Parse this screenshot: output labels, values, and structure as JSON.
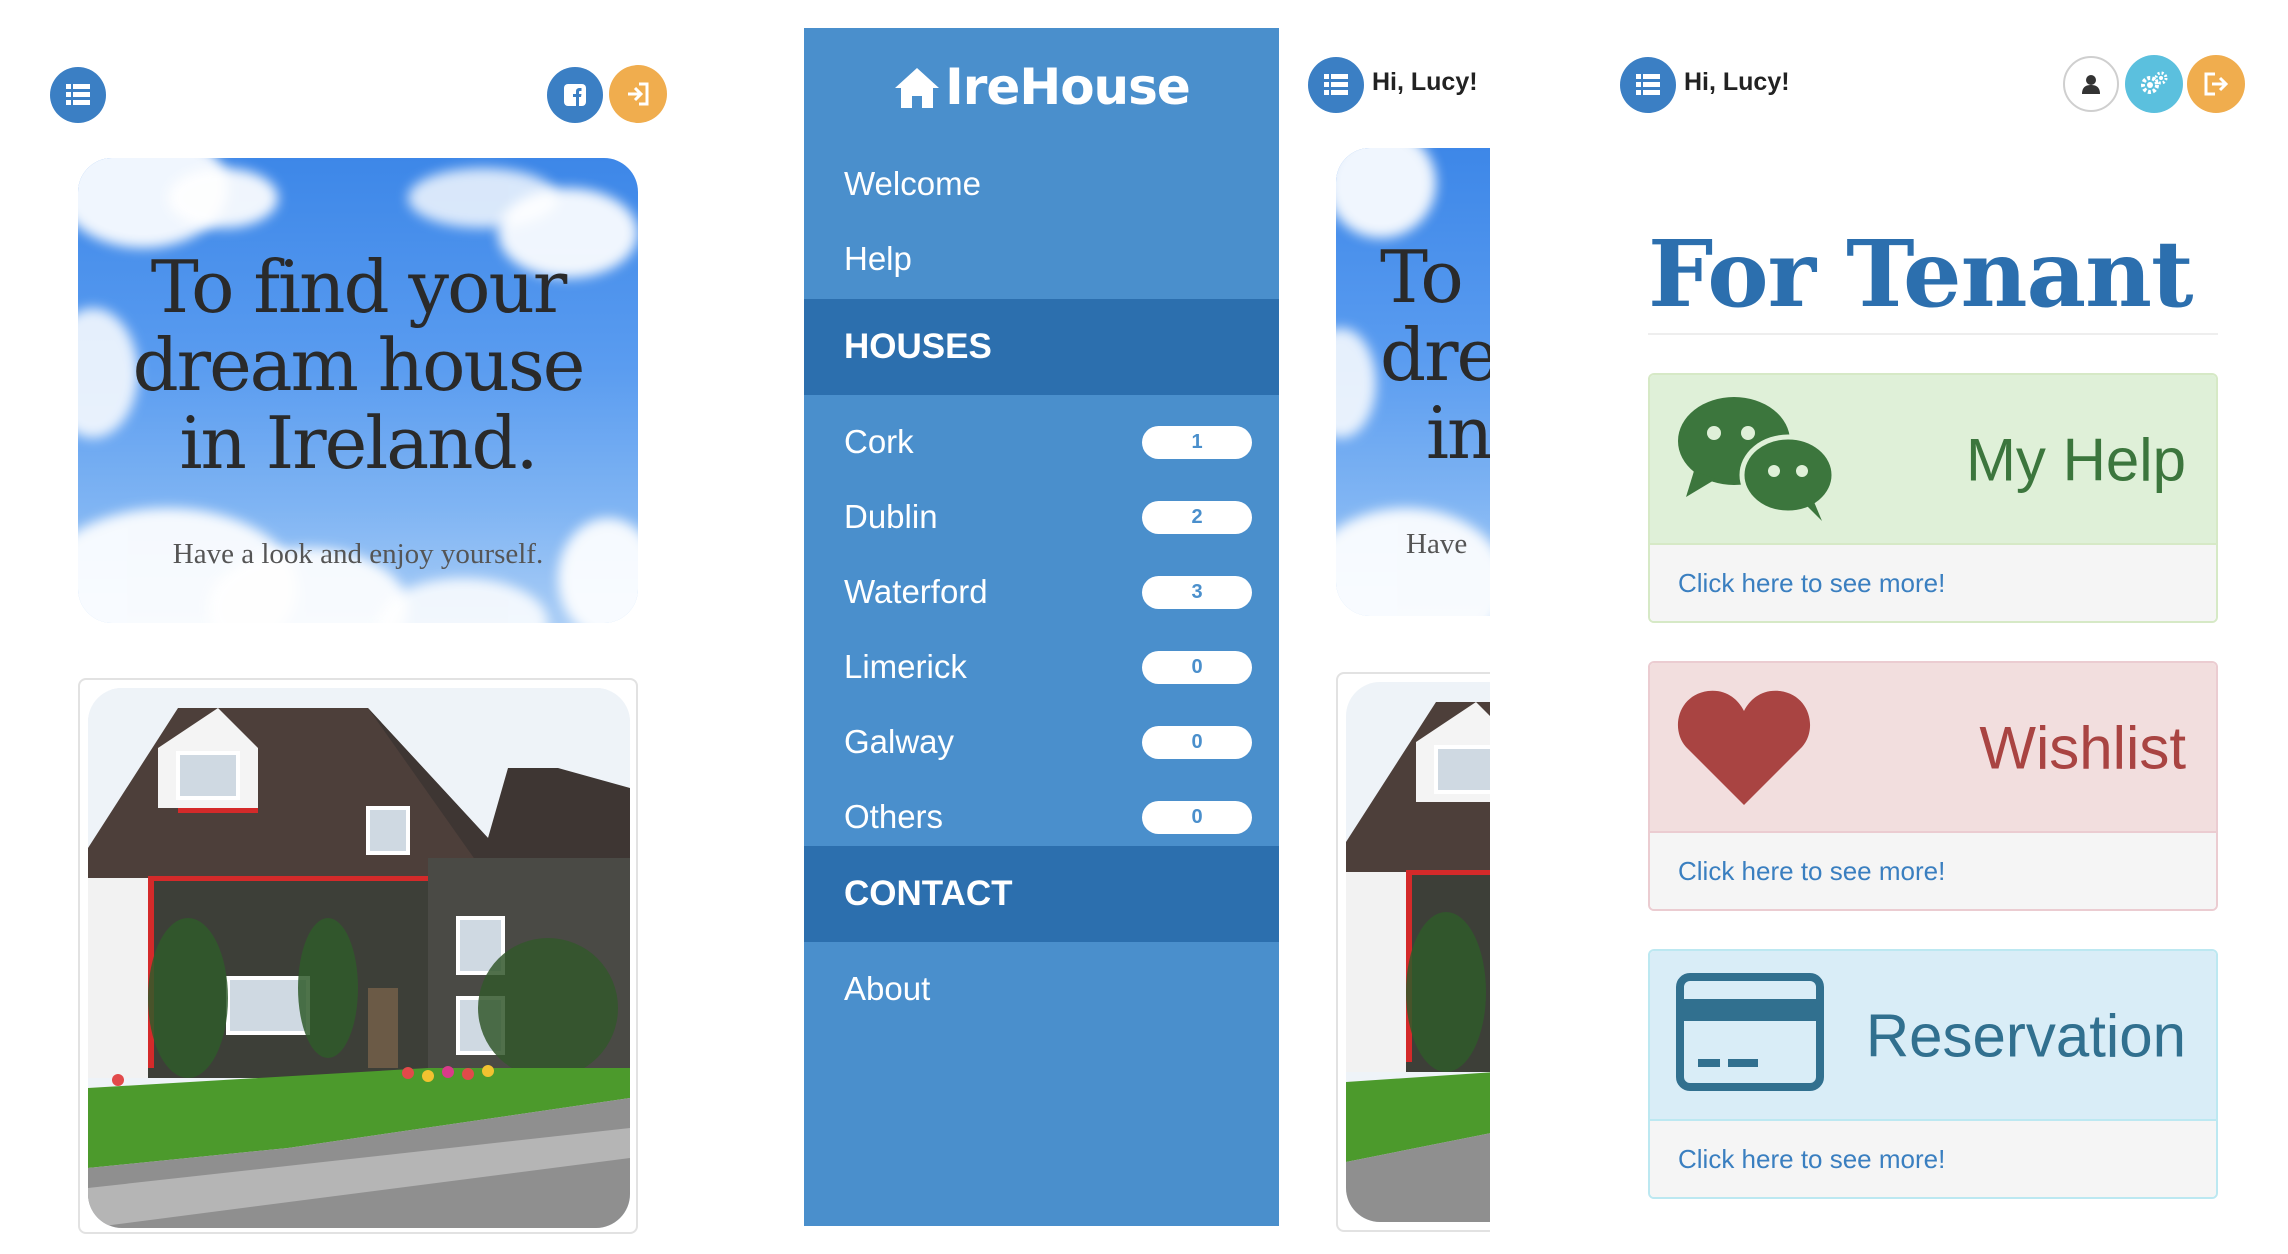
{
  "panel1": {
    "hero": {
      "title_line1": "To find your",
      "title_line2": "dream house",
      "title_line3": "in Ireland.",
      "subtitle": "Have a look and enjoy yourself."
    },
    "icons": [
      "list-icon",
      "facebook-icon",
      "sign-in-icon"
    ]
  },
  "menu": {
    "brand": "IreHouse",
    "items_top": [
      {
        "label": "Welcome"
      },
      {
        "label": "Help"
      }
    ],
    "houses_header": "HOUSES",
    "houses": [
      {
        "label": "Cork",
        "count": "1"
      },
      {
        "label": "Dublin",
        "count": "2"
      },
      {
        "label": "Waterford",
        "count": "3"
      },
      {
        "label": "Limerick",
        "count": "0"
      },
      {
        "label": "Galway",
        "count": "0"
      },
      {
        "label": "Others",
        "count": "0"
      }
    ],
    "contact_header": "CONTACT",
    "contact_items": [
      {
        "label": "About"
      }
    ]
  },
  "panel3": {
    "greeting": "Hi, Lucy!",
    "hero_partial_line1": "To",
    "hero_partial_line2": "dre",
    "hero_partial_line3": "in",
    "hero_partial_sub": "Have"
  },
  "panel4": {
    "greeting": "Hi, Lucy!",
    "title": "For Tenant",
    "cards": [
      {
        "label": "My Help",
        "link": "Click here to see more!",
        "icon": "wechat-icon",
        "color": "#3c763d",
        "bg": "#dff0d8",
        "border": "#d6e9c6"
      },
      {
        "label": "Wishlist",
        "link": "Click here to see more!",
        "icon": "heart-icon",
        "color": "#a94442",
        "bg": "#f2dede",
        "border": "#ebccd1"
      },
      {
        "label": "Reservation",
        "link": "Click here to see more!",
        "icon": "credit-card-icon",
        "color": "#31708f",
        "bg": "#d9edf7",
        "border": "#bce8f1"
      }
    ]
  },
  "colors": {
    "primary": "#3b7fc4",
    "menu_bg": "#4a8fcc",
    "menu_header": "#2c6fae",
    "orange": "#f0ad4e",
    "cyan": "#5bc0de"
  }
}
